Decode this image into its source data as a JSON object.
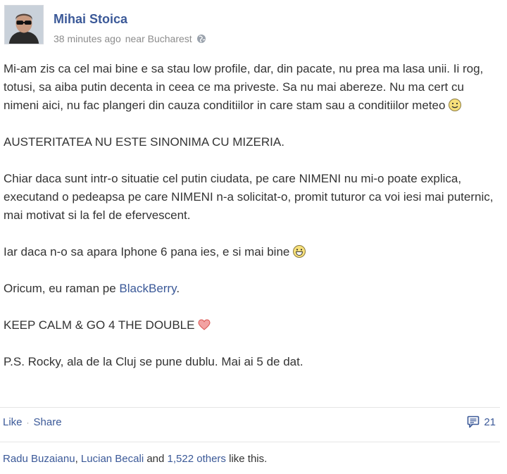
{
  "header": {
    "author": "Mihai Stoica",
    "timestamp": "38 minutes ago",
    "location": "near Bucharest",
    "privacy_icon": "globe-icon"
  },
  "post": {
    "para1": "Mi-am zis ca cel mai bine e sa stau low profile, dar, din pacate, nu prea ma lasa unii. Ii rog, totusi, sa aiba putin decenta in ceea ce ma priveste. Sa nu mai abereze. Nu ma cert cu nimeni aici, nu fac plangeri din cauza conditiilor in care stam sau a conditiilor meteo",
    "para2": "AUSTERITATEA NU ESTE SINONIMA CU MIZERIA.",
    "para3": "Chiar daca sunt intr-o situatie cel putin ciudata, pe care NIMENI nu mi-o poate explica, executand o pedeapsa pe care NIMENI n-a solicitat-o, promit tuturor ca voi iesi mai puternic, mai motivat si la fel de efervescent.",
    "para4": "Iar daca n-o sa apara Iphone 6 pana ies, e si mai bine",
    "para5_prefix": "Oricum, eu raman pe ",
    "para5_link": "BlackBerry",
    "para5_suffix": ".",
    "para6": "KEEP CALM & GO 4 THE DOUBLE",
    "para7": "P.S. Rocky, ala de la Cluj se pune dublu. Mai ai 5 de dat."
  },
  "actions": {
    "like": "Like",
    "separator": "·",
    "share": "Share",
    "comment_count": "21"
  },
  "likes": {
    "user1": "Radu Buzaianu",
    "separator1": ", ",
    "user2": "Lucian Becali",
    "and_text": " and ",
    "others": "1,522 others",
    "suffix": " like this."
  },
  "colors": {
    "link": "#3b5998",
    "meta": "#8c8c8c",
    "heart": "#e05a5a"
  }
}
